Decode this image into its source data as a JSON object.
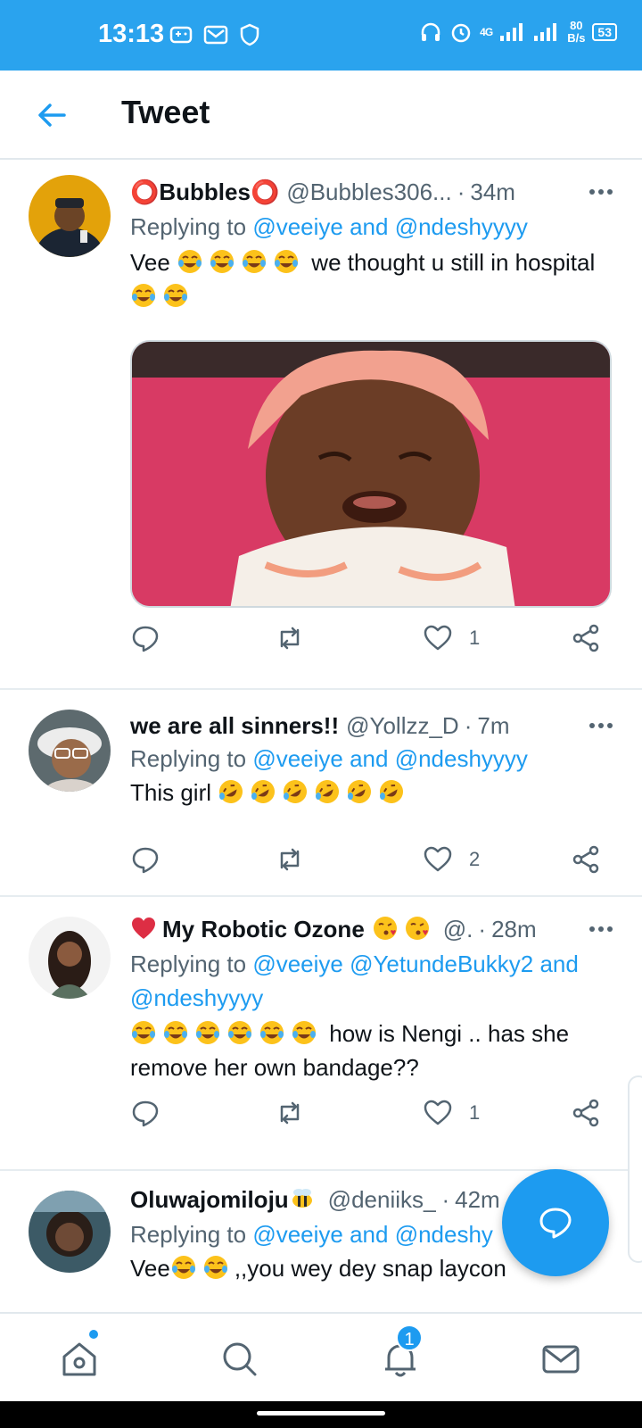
{
  "status_bar": {
    "time": "13:13",
    "network": "4G",
    "speed_value": "80",
    "speed_unit": "B/s",
    "battery": "53"
  },
  "header": {
    "title": "Tweet"
  },
  "tweets": [
    {
      "name": "⭕Bubbles⭕",
      "handle": "@Bubbles306...",
      "time": "34m",
      "replying_prefix": "Replying to ",
      "mentions": "@veeiye and @ndeshyyyy",
      "text_parts": [
        "Vee",
        "we thought u still in hospital"
      ],
      "likes": "1",
      "has_media": true
    },
    {
      "name": "we are all sinners!!",
      "handle": "@Yollzz_D",
      "time": "7m",
      "replying_prefix": "Replying to ",
      "mentions": "@veeiye and @ndeshyyyy",
      "text_parts": [
        "This girl"
      ],
      "likes": "2"
    },
    {
      "name": "My Robotic Ozone",
      "handle": "@.",
      "time": "28m",
      "replying_prefix": "Replying to ",
      "mentions": "@veeiye @YetundeBukky2 and @ndeshyyyy",
      "text_parts": [
        "how is Nengi .. has she remove her own bandage??"
      ],
      "likes": "1"
    },
    {
      "name": "Oluwajomiloju",
      "handle": "@deniiks_",
      "time": "42m",
      "replying_prefix": "Replying to ",
      "mentions": "@veeiye and @ndeshy",
      "text_parts": [
        "Vee",
        ",,you wey dey snap laycon"
      ]
    }
  ],
  "bottom_nav": {
    "items": [
      "home-icon",
      "search-icon",
      "notifications-icon",
      "messages-icon"
    ],
    "notification_count": "1"
  },
  "colors": {
    "brand": "#1d9bf0",
    "status_bar": "#2aa3ee",
    "text": "#0f1419",
    "secondary": "#536471"
  }
}
